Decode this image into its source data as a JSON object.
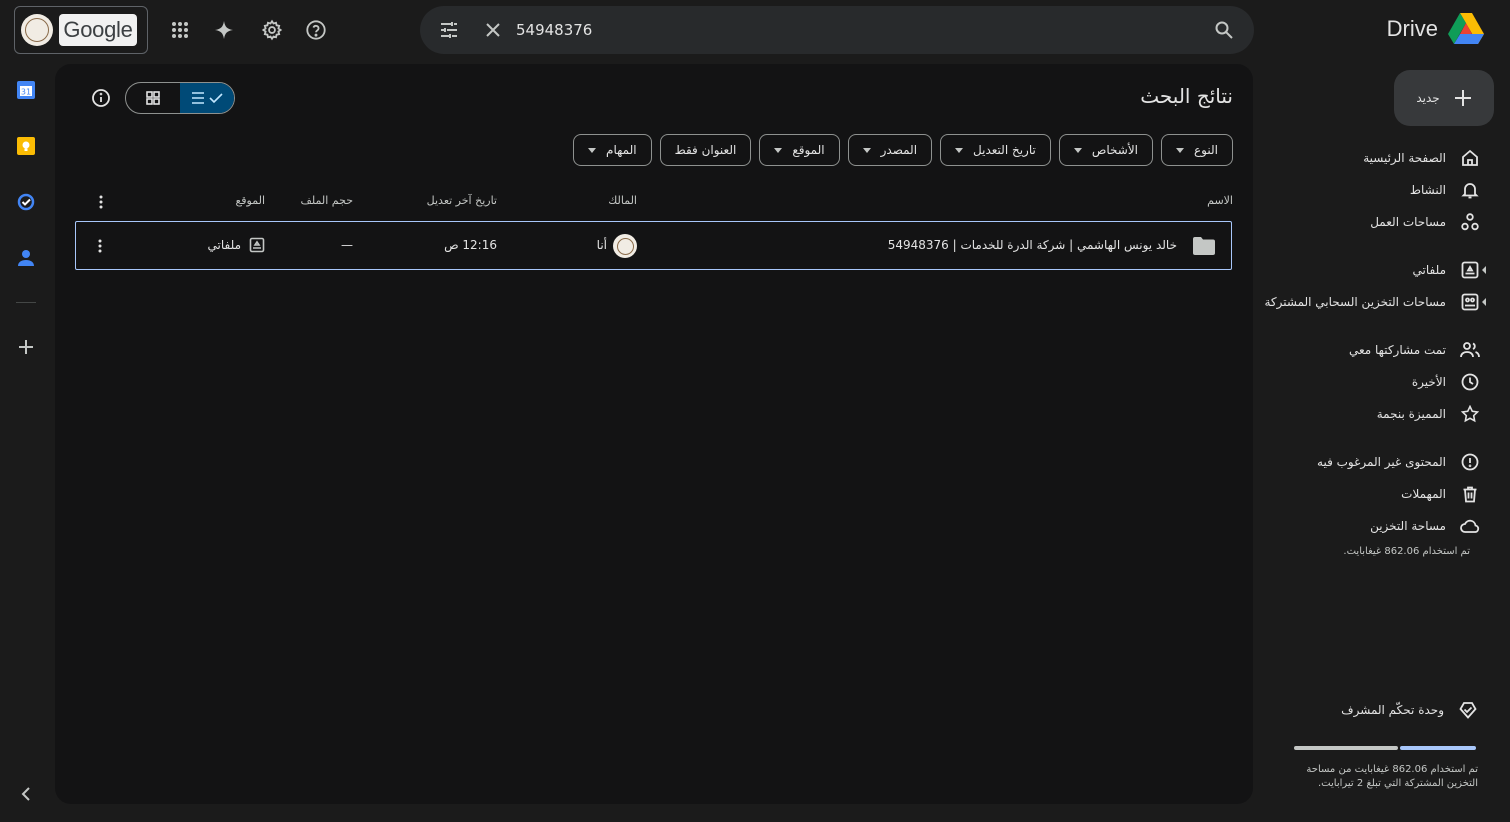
{
  "header": {
    "logo_text": "Google",
    "product_title": "Drive",
    "search_value": "54948376"
  },
  "main": {
    "page_title": "نتائج البحث",
    "filters": [
      "النوع",
      "الأشخاص",
      "تاريخ التعديل",
      "المصدر",
      "الموقع",
      "العنوان فقط",
      "المهام"
    ],
    "columns": {
      "name": "الاسم",
      "owner": "المالك",
      "modified": "تاريخ آخر تعديل",
      "size": "حجم الملف",
      "location": "الموقع"
    },
    "rows": [
      {
        "name": "خالد يونس الهاشمي | شركة الدرة للخدمات | 54948376",
        "owner": "أنا",
        "modified": "12:16 ص",
        "size": "—",
        "location": "ملفاتي"
      }
    ]
  },
  "sidebar": {
    "new_label": "جديد",
    "items": [
      {
        "label": "الصفحة الرئيسية",
        "icon": "home-icon"
      },
      {
        "label": "النشاط",
        "icon": "bell-icon"
      },
      {
        "label": "مساحات العمل",
        "icon": "workspaces-icon"
      },
      {
        "label": "ملفاتي",
        "icon": "my-drive-icon"
      },
      {
        "label": "مساحات التخزين السحابي المشتركة",
        "icon": "shared-drives-icon"
      },
      {
        "label": "تمت مشاركتها معي",
        "icon": "people-icon"
      },
      {
        "label": "الأخيرة",
        "icon": "clock-icon"
      },
      {
        "label": "المميزة بنجمة",
        "icon": "star-icon"
      },
      {
        "label": "المحتوى غير المرغوب فيه",
        "icon": "spam-icon"
      },
      {
        "label": "المهملات",
        "icon": "trash-icon"
      },
      {
        "label": "مساحة التخزين",
        "icon": "cloud-icon"
      }
    ],
    "storage_used": "تم استخدام 862.06 غيغابايت.",
    "admin_console": "وحدة تحكّم المشرف",
    "storage_note_line1": "تم استخدام 862.06 غيغابايت من مساحة",
    "storage_note_line2": "التخزين المشتركة التي تبلغ 2 تيرابايت.",
    "storage_fraction": 0.43
  }
}
